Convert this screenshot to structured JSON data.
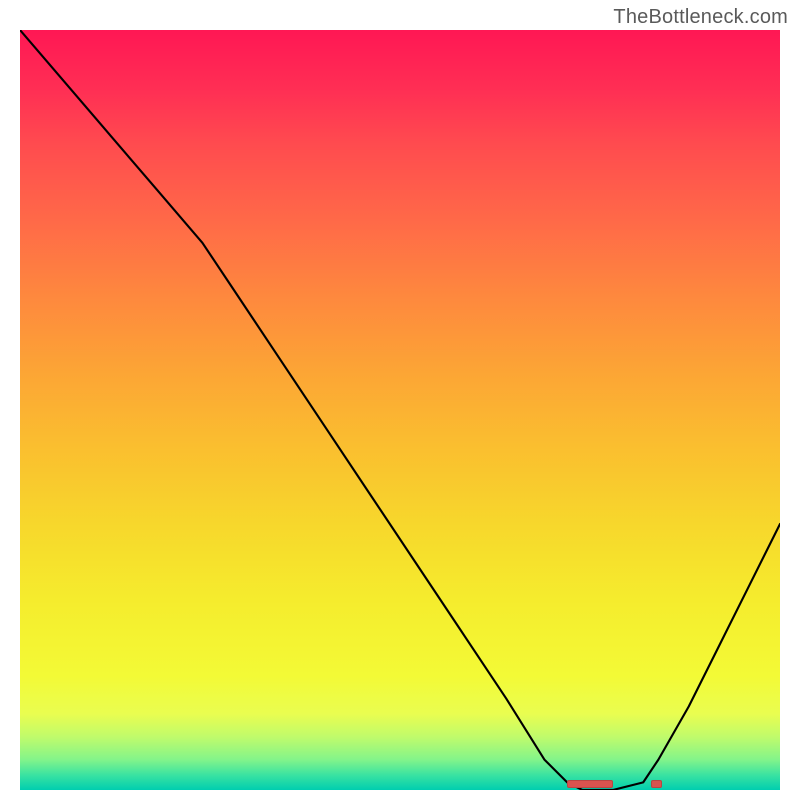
{
  "watermark": "TheBottleneck.com",
  "chart_data": {
    "type": "line",
    "title": "",
    "xlabel": "",
    "ylabel": "",
    "xlim": [
      0,
      100
    ],
    "ylim": [
      0,
      100
    ],
    "grid": false,
    "series": [
      {
        "name": "bottleneck-curve",
        "x": [
          0,
          6,
          12,
          18,
          24,
          28,
          34,
          40,
          46,
          52,
          58,
          64,
          69,
          72,
          74,
          78,
          82,
          84,
          88,
          92,
          96,
          100
        ],
        "values": [
          100,
          93,
          86,
          79,
          72,
          66,
          57,
          48,
          39,
          30,
          21,
          12,
          4,
          1,
          0,
          0,
          1,
          4,
          11,
          19,
          27,
          35
        ]
      }
    ],
    "annotations": [
      {
        "type": "marker",
        "name": "min-segment-a",
        "x": 72,
        "width": 6
      },
      {
        "type": "marker",
        "name": "min-point-b",
        "x": 83,
        "width": 1.5
      }
    ],
    "background_gradient": {
      "direction": "vertical",
      "stops": [
        {
          "pct": 0,
          "color": "#ff1754"
        },
        {
          "pct": 50,
          "color": "#fbb030"
        },
        {
          "pct": 85,
          "color": "#f3fa36"
        },
        {
          "pct": 100,
          "color": "#00ceaf"
        }
      ]
    }
  }
}
